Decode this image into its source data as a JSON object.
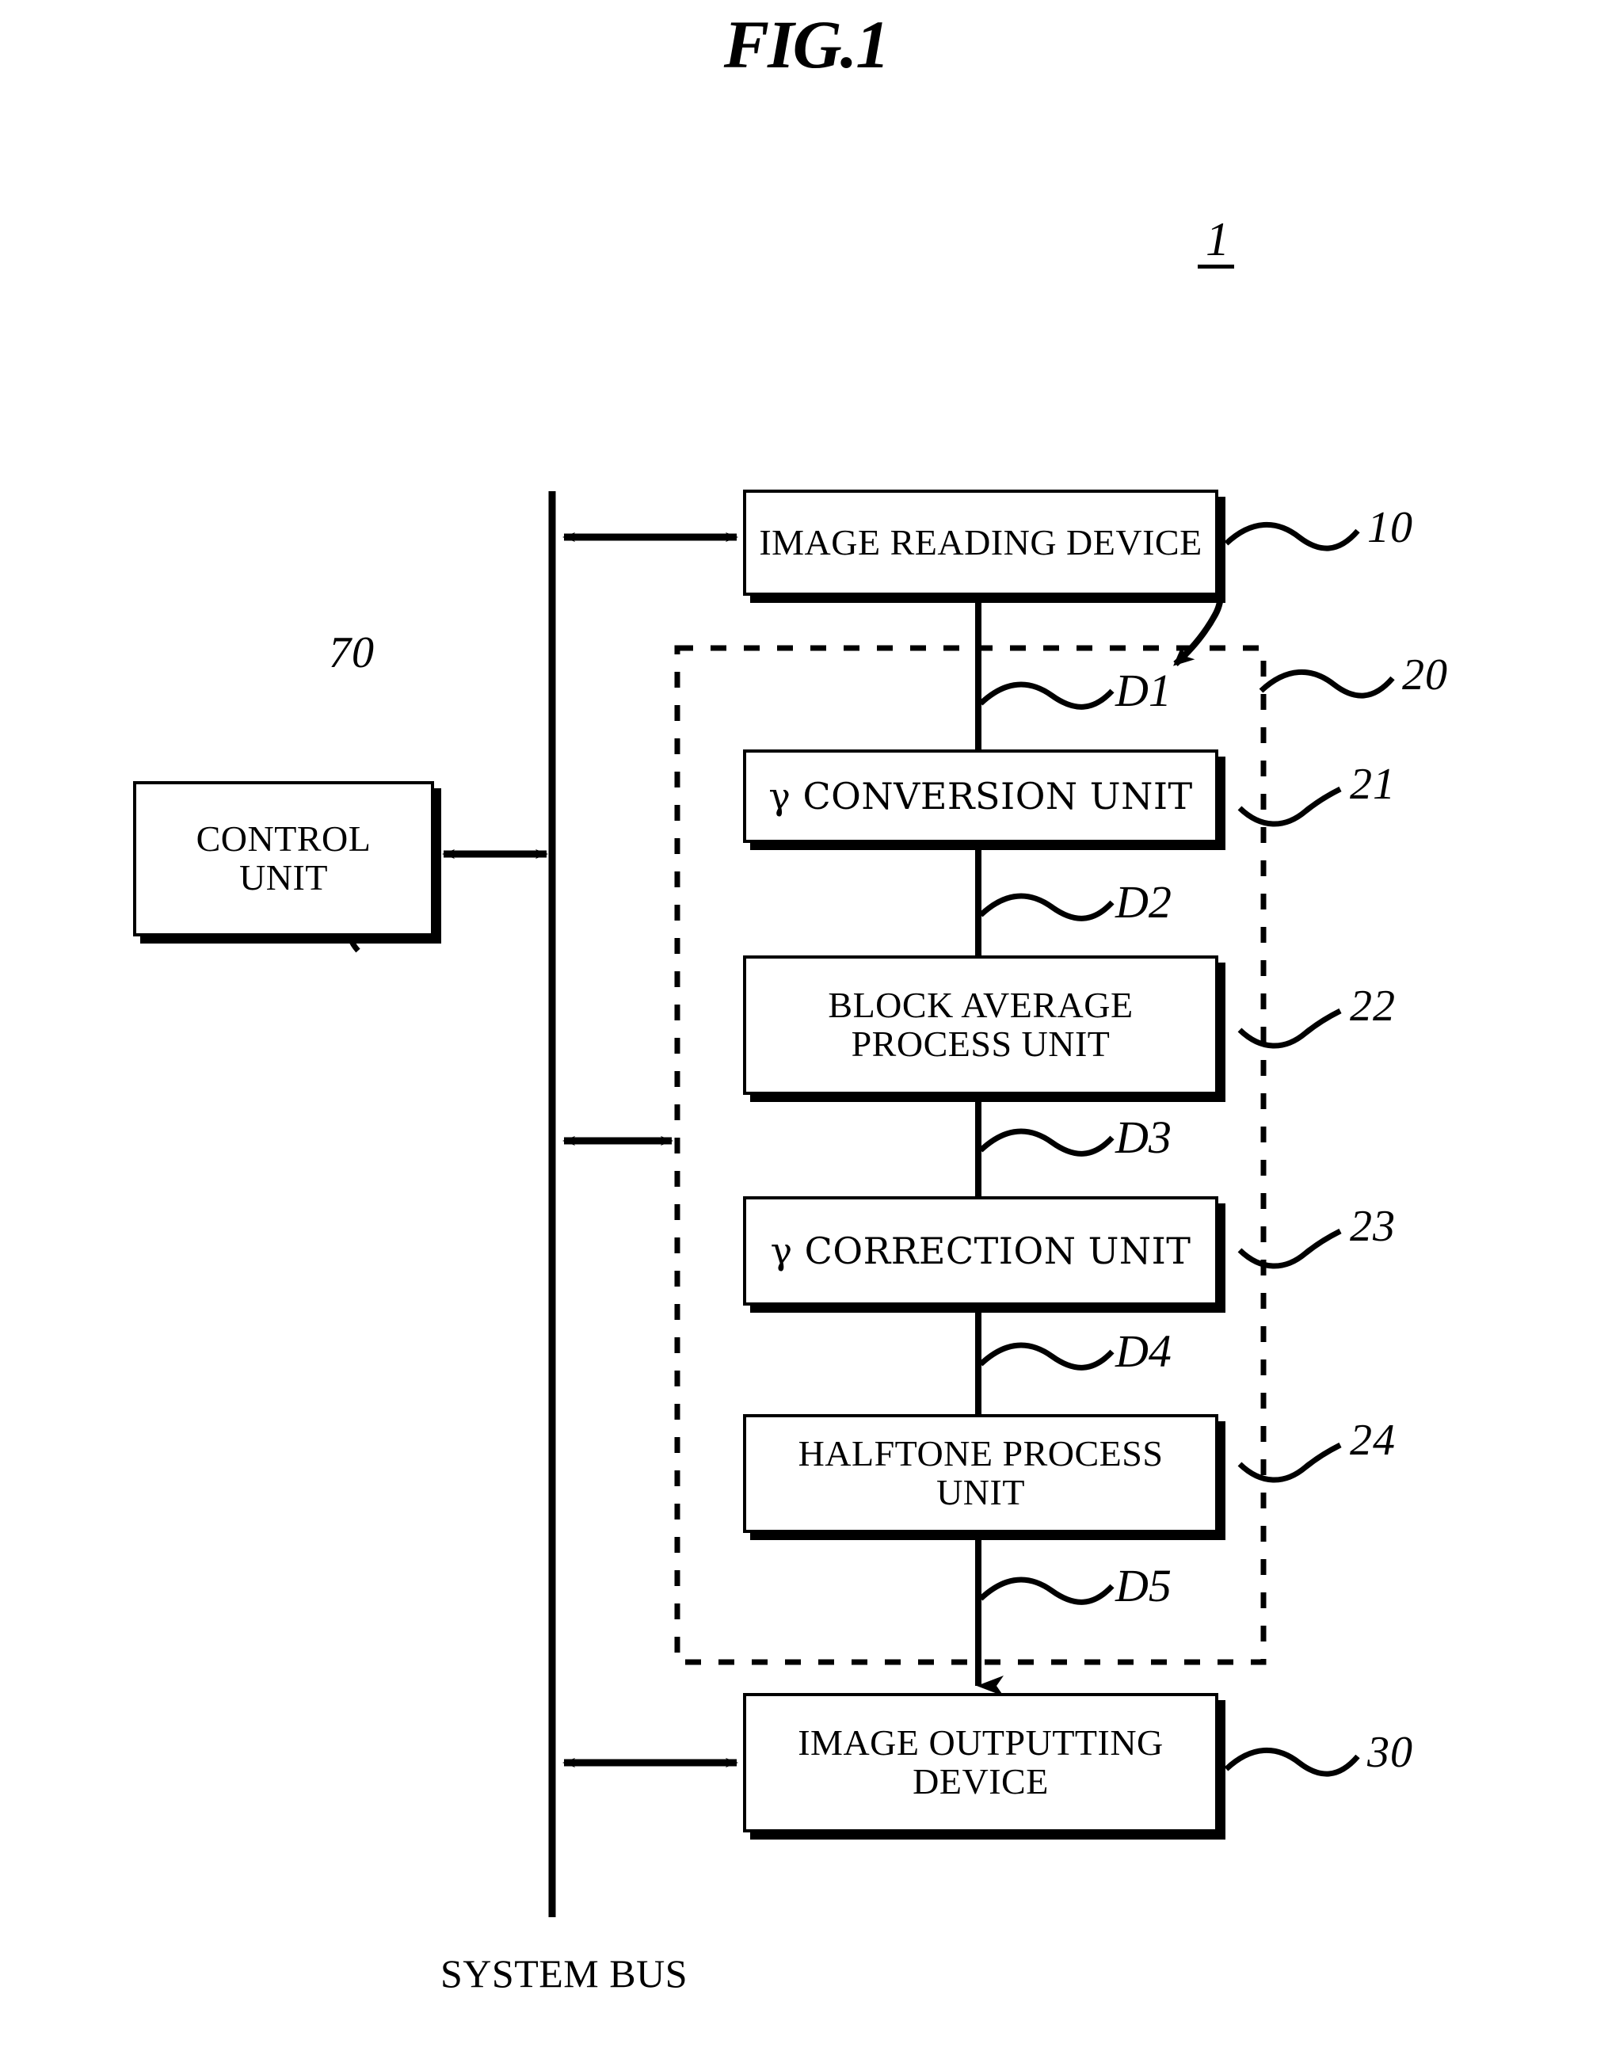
{
  "figure": {
    "title": "FIG.1",
    "system_ref": "1",
    "bus_label": "SYSTEM BUS"
  },
  "blocks": [
    {
      "id": "image-reading-device",
      "lines": [
        "IMAGE READING DEVICE"
      ],
      "ref": "10"
    },
    {
      "id": "gamma-conversion-unit",
      "lines": [
        "γ  CONVERSION UNIT"
      ],
      "ref": "21"
    },
    {
      "id": "block-average-process-unit",
      "lines": [
        "BLOCK AVERAGE",
        "PROCESS UNIT"
      ],
      "ref": "22"
    },
    {
      "id": "gamma-correction-unit",
      "lines": [
        "γ  CORRECTION UNIT"
      ],
      "ref": "23"
    },
    {
      "id": "halftone-process-unit",
      "lines": [
        "HALFTONE PROCESS",
        "UNIT"
      ],
      "ref": "24"
    },
    {
      "id": "image-outputting-device",
      "lines": [
        "IMAGE OUTPUTTING",
        "DEVICE"
      ],
      "ref": "30"
    },
    {
      "id": "control-unit",
      "lines": [
        "CONTROL",
        "UNIT"
      ],
      "ref": "70"
    }
  ],
  "image_processing_group": {
    "ref": "20"
  },
  "signals": [
    {
      "id": "d1",
      "label": "D1"
    },
    {
      "id": "d2",
      "label": "D2"
    },
    {
      "id": "d3",
      "label": "D3"
    },
    {
      "id": "d4",
      "label": "D4"
    },
    {
      "id": "d5",
      "label": "D5"
    }
  ],
  "colors": {
    "ink": "#000000",
    "paper": "#ffffff"
  }
}
